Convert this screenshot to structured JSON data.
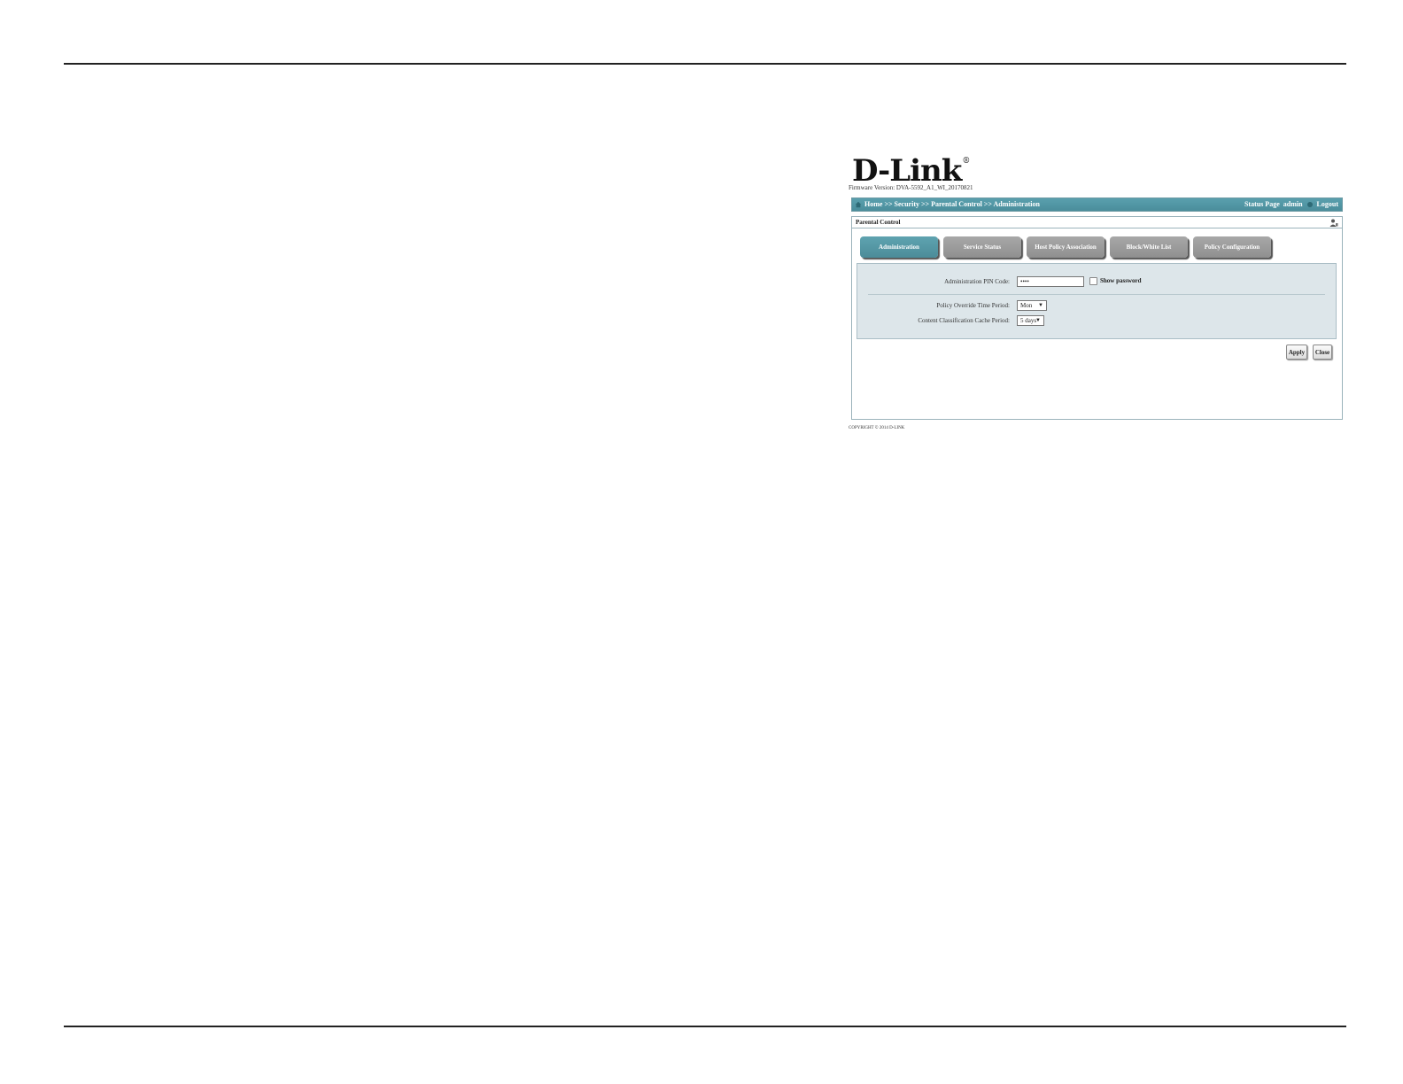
{
  "logo": {
    "text": "D-Link",
    "registered": "®"
  },
  "firmware": "Firmware Version: DVA-5592_A1_WI_20170821",
  "navbar": {
    "breadcrumb": "Home >> Security >> Parental Control >> Administration",
    "status_page": "Status Page",
    "user": "admin",
    "logout": "Logout"
  },
  "panel": {
    "title": "Parental Control"
  },
  "tabs": [
    {
      "label": "Administration",
      "active": true
    },
    {
      "label": "Service Status",
      "active": false
    },
    {
      "label": "Host Policy Association",
      "active": false
    },
    {
      "label": "Block/White List",
      "active": false
    },
    {
      "label": "Policy Configuration",
      "active": false
    }
  ],
  "form": {
    "pin_label": "Administration PIN Code:",
    "pin_value": "••••",
    "show_password": "Show password",
    "override_label": "Policy Override Time Period:",
    "override_value": "Mon",
    "cache_label": "Content Classification Cache Period:",
    "cache_value": "5 days"
  },
  "buttons": {
    "apply": "Apply",
    "close": "Close"
  },
  "copyright": "COPYRIGHT © 2014 D-LINK",
  "colors": {
    "accent": "#4f93a0",
    "tab_inactive": "#9a9a9a",
    "form_bg": "#dde6ea"
  }
}
